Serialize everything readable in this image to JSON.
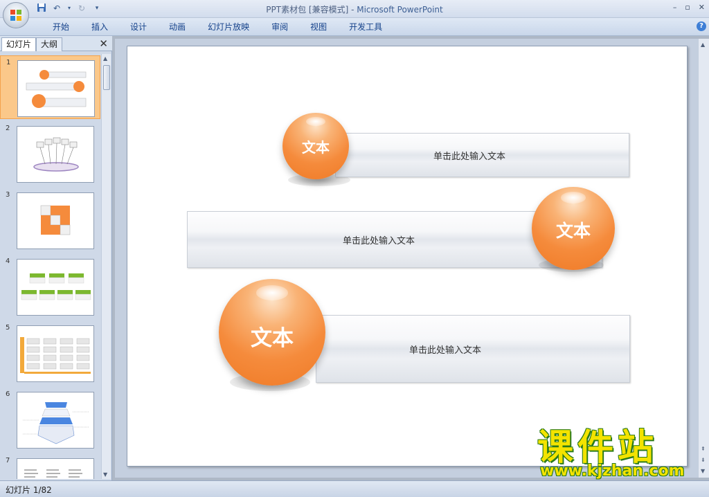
{
  "window": {
    "title_file": "PPT素材包 [兼容模式]",
    "title_sep": " - ",
    "title_app": "Microsoft PowerPoint",
    "controls": [
      "–",
      "▫",
      "✕"
    ]
  },
  "qat": {
    "save_icon": "save-icon",
    "undo_icon": "undo-icon",
    "redo_icon": "redo-icon",
    "more": "▾"
  },
  "ribbon": {
    "tabs": [
      "开始",
      "插入",
      "设计",
      "动画",
      "幻灯片放映",
      "审阅",
      "视图",
      "开发工具"
    ],
    "help": "?"
  },
  "panel": {
    "tabs": [
      "幻灯片",
      "大纲"
    ],
    "close": "✕",
    "thumbs": [
      {
        "num": "1"
      },
      {
        "num": "2"
      },
      {
        "num": "3"
      },
      {
        "num": "4"
      },
      {
        "num": "5"
      },
      {
        "num": "6"
      },
      {
        "num": "7"
      }
    ]
  },
  "slide": {
    "rows": [
      {
        "orb_text": "文本",
        "bar_text": "单击此处输入文本"
      },
      {
        "orb_text": "文本",
        "bar_text": "单击此处输入文本"
      },
      {
        "orb_text": "文本",
        "bar_text": "单击此处输入文本"
      }
    ]
  },
  "status": {
    "slide_counter": "幻灯片 1/82"
  },
  "watermark": {
    "big": "课件站",
    "url": "www.kjzhan.com"
  },
  "colors": {
    "accent_orange": "#f58b3c",
    "title_blue": "#3d5f94",
    "ribbon_text": "#15428b"
  }
}
